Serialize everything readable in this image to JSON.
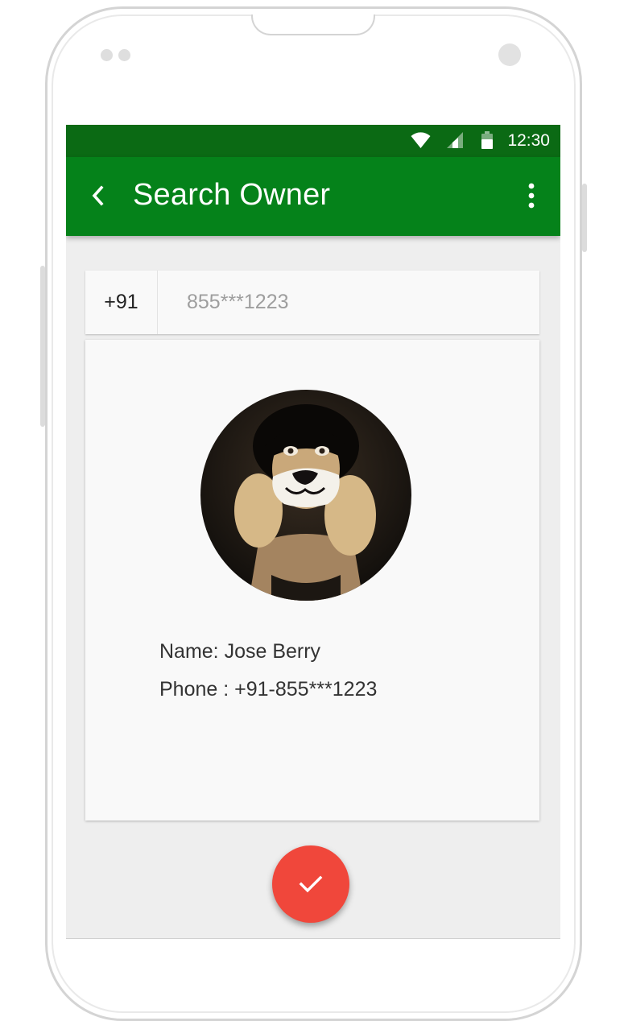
{
  "status_bar": {
    "time": "12:30",
    "icons": [
      "wifi-icon",
      "cell-signal-icon",
      "battery-icon"
    ]
  },
  "app_bar": {
    "title": "Search Owner",
    "back_icon": "chevron-left-icon",
    "menu_icon": "more-vert-icon"
  },
  "search": {
    "country_code": "+91",
    "phone_placeholder": "855***1223",
    "phone_value": ""
  },
  "result": {
    "avatar": "profile-photo",
    "name_line": "Name: Jose Berry",
    "phone_line": "Phone : +91-855***1223"
  },
  "fab": {
    "icon": "check-icon"
  },
  "colors": {
    "status_bar": "#0b6a14",
    "app_bar": "#05821a",
    "screen_background": "#eeeeee",
    "card_background": "#f9f9f9",
    "fab": "#f0473b",
    "text_primary": "#333333",
    "placeholder": "#9e9e9e"
  }
}
